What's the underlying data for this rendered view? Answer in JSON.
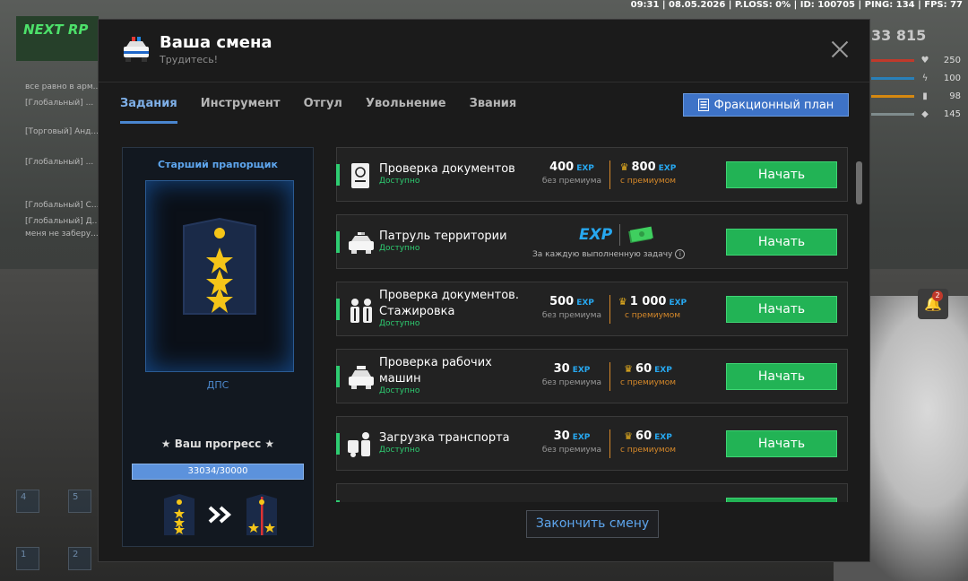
{
  "hud": {
    "top_stats": "09:31 | 08.05.2026 | P.LOSS: 0% | ID: 100705 | PING: 134 | FPS: 77",
    "logo": "NEXT RP",
    "money": "33 815",
    "bars": [
      {
        "icon": "health-icon",
        "value": "250",
        "color": "#c0392b"
      },
      {
        "icon": "stamina-icon",
        "value": "100",
        "color": "#2980b9"
      },
      {
        "icon": "hunger-icon",
        "value": "98",
        "color": "#d68910"
      },
      {
        "icon": "armor-icon",
        "value": "145",
        "color": "#7f8c8d"
      }
    ],
    "chat": [
      "все равно в арм...",
      "[Глобальный] ...",
      "[Торговый] Анд...",
      "[Глобальный] ...",
      "[Глобальный] С...",
      "[Глобальный] Д...",
      "меня не заберу..."
    ],
    "notification_count": "2"
  },
  "modal": {
    "title": "Ваша смена",
    "subtitle": "Трудитесь!",
    "tabs": [
      {
        "label": "Задания",
        "active": true
      },
      {
        "label": "Инструмент",
        "active": false
      },
      {
        "label": "Отгул",
        "active": false
      },
      {
        "label": "Увольнение",
        "active": false
      },
      {
        "label": "Звания",
        "active": false
      }
    ],
    "faction_plan_label": "Фракционный план",
    "rank": {
      "title": "Старший прапорщик",
      "org": "ДПС",
      "progress_label": "★ Ваш прогресс ★",
      "progress_text": "33034/30000",
      "progress_fraction": 1.0
    },
    "tasks": [
      {
        "name": "Проверка документов",
        "status": "Доступно",
        "base": "400",
        "premium": "800",
        "base_label": "без премиума",
        "premium_label": "с премиумом",
        "button": "Начать",
        "icon": "passport-icon"
      },
      {
        "name": "Патруль территории",
        "status": "Доступно",
        "per_task": "За каждую выполненную задачу",
        "exp_label": "EXP",
        "button": "Начать",
        "icon": "police-car-icon"
      },
      {
        "name": "Проверка документов. Стажировка",
        "status": "Доступно",
        "base": "500",
        "premium": "1 000",
        "base_label": "без премиума",
        "premium_label": "с премиумом",
        "button": "Начать",
        "icon": "officers-icon"
      },
      {
        "name": "Проверка рабочих машин",
        "status": "Доступно",
        "base": "30",
        "premium": "60",
        "base_label": "без премиума",
        "premium_label": "с премиумом",
        "button": "Начать",
        "icon": "taxi-icon"
      },
      {
        "name": "Загрузка транспорта",
        "status": "Доступно",
        "base": "30",
        "premium": "60",
        "base_label": "без премиума",
        "premium_label": "с премиумом",
        "button": "Начать",
        "icon": "loader-icon"
      }
    ],
    "exp_tag": "EXP",
    "end_shift_label": "Закончить смену"
  }
}
